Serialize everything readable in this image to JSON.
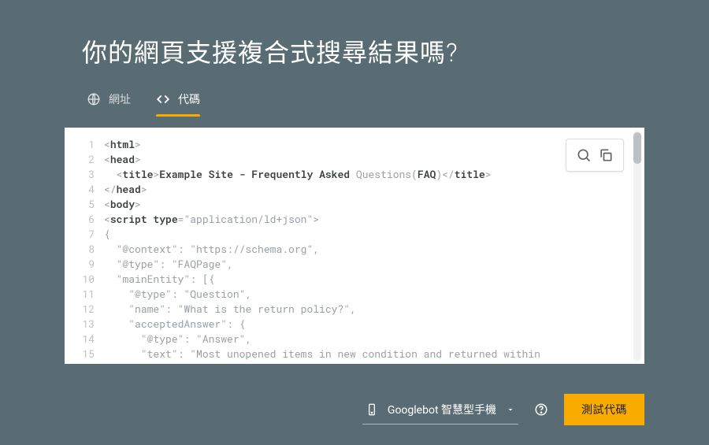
{
  "page_title": "你的網頁支援複合式搜尋結果嗎?",
  "tabs": {
    "url": {
      "label": "網址"
    },
    "code": {
      "label": "代碼"
    }
  },
  "code": {
    "line_numbers": [
      "1",
      "2",
      "3",
      "4",
      "5",
      "6",
      "7",
      "8",
      "9",
      "10",
      "11",
      "12",
      "13",
      "14",
      "15"
    ],
    "lines_html": [
      "<span class='p'>&lt;</span><span class='b'>html</span><span class='p'>&gt;</span>",
      "<span class='p'>&lt;</span><span class='b'>head</span><span class='p'>&gt;</span>",
      "  <span class='p'>&lt;</span><span class='b'>title</span><span class='p'>&gt;</span><span class='b'>Example Site - Frequently Asked </span><span class='p'>Questions(</span><span class='b'>FAQ</span><span class='p'>)&lt;/</span><span class='b'>title</span><span class='p'>&gt;</span>",
      "<span class='p'>&lt;/</span><span class='b'>head</span><span class='p'>&gt;</span>",
      "<span class='p'>&lt;</span><span class='b'>body</span><span class='p'>&gt;</span>",
      "<span class='p'>&lt;</span><span class='b'>script type</span><span class='p'>=\"application/ld+json\"&gt;</span>",
      "<span class='p'>{</span>",
      "  <span class='p'>\"@context\": \"https://schema.org\",</span>",
      "  <span class='p'>\"@type\": \"FAQPage\",</span>",
      "  <span class='p'>\"mainEntity\": [{</span>",
      "    <span class='p'>\"@type\": \"Question\",</span>",
      "    <span class='p'>\"name\": \"What is the return policy?\",</span>",
      "    <span class='p'>\"acceptedAnswer\": {</span>",
      "      <span class='p'>\"@type\": \"Answer\",</span>",
      "      <span class='p'>\"text\": \"Most unopened items in new condition and returned within</span>"
    ]
  },
  "footer": {
    "selector_label": "Googlebot 智慧型手機",
    "test_button": "測試代碼"
  }
}
